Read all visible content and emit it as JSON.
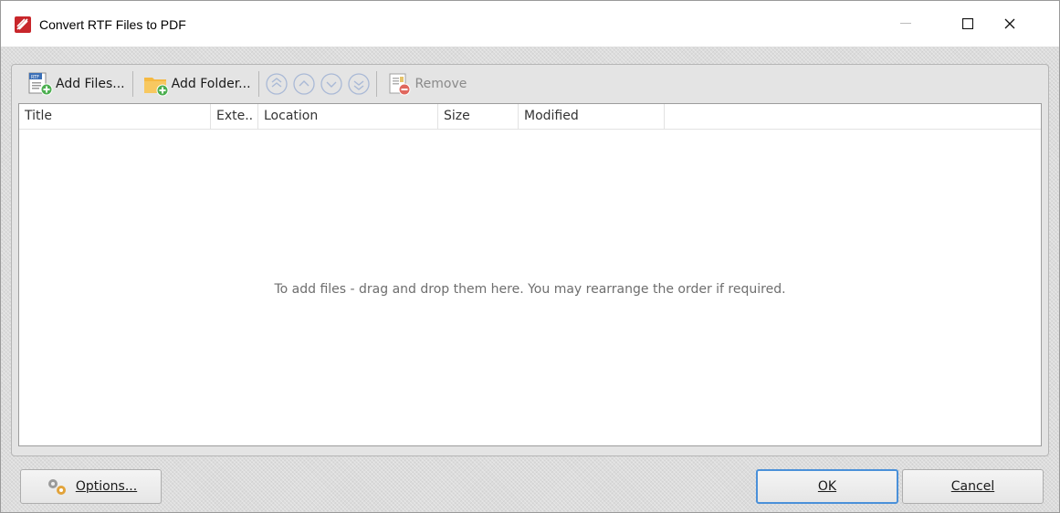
{
  "window": {
    "title": "Convert RTF Files to PDF",
    "controls": {
      "minimize": "—",
      "maximize": "☐",
      "close": "✕"
    }
  },
  "toolbar": {
    "add_files_label": "Add Files...",
    "add_folder_label": "Add Folder...",
    "remove_label": "Remove",
    "move_buttons": [
      "move-to-top",
      "move-up",
      "move-down",
      "move-to-bottom"
    ]
  },
  "file_list": {
    "columns": [
      "Title",
      "Exte..",
      "Location",
      "Size",
      "Modified"
    ],
    "rows": [],
    "empty_hint": "To add files - drag and drop them here. You may rearrange the order if required."
  },
  "footer": {
    "options_label": "Options...",
    "ok_label": "OK",
    "cancel_label": "Cancel"
  },
  "colors": {
    "accent": "#4a90d9",
    "app_icon": "#c8262b"
  }
}
